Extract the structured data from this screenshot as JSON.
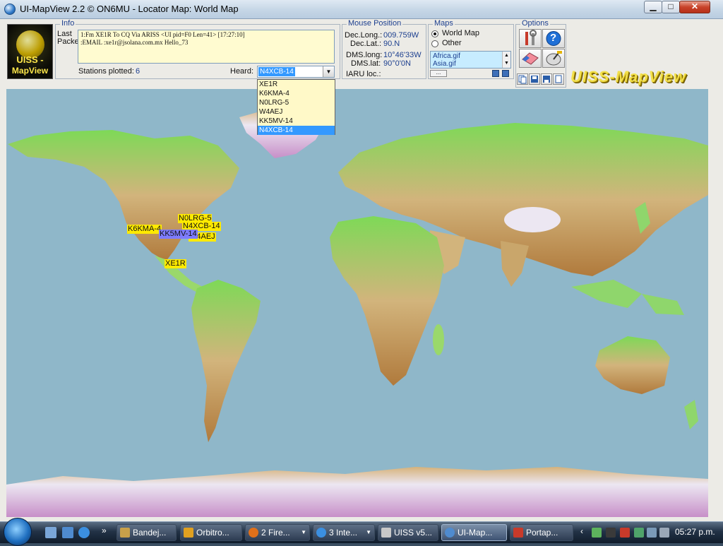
{
  "window": {
    "title": "UI-MapView 2.2 © ON6MU - Locator Map: World Map",
    "controls": {
      "minimize": "▁",
      "maximize": "□",
      "close": "✕"
    }
  },
  "logo": {
    "line1": "UISS -",
    "line2": "MapView"
  },
  "info": {
    "legend": "Info",
    "last_label": "Last",
    "packet_label": "Packet:",
    "packet_lines": [
      "1:Fm XE1R To CQ Via ARISS <UI pid=F0 Len=41> [17:27:10]",
      ":EMAIL   :xe1r@jsolana.com.mx Hello_73"
    ],
    "stations_label": "Stations plotted:",
    "stations_value": "6",
    "heard_label": "Heard:",
    "heard_value": "N4XCB-14",
    "heard_options": [
      "XE1R",
      "K6KMA-4",
      "N0LRG-5",
      "W4AEJ",
      "KK5MV-14",
      "N4XCB-14"
    ]
  },
  "mouse": {
    "legend": "Mouse Position",
    "dec_long_label": "Dec.Long.:",
    "dec_long_value": "009.759W",
    "dec_lat_label": "Dec.Lat.:",
    "dec_lat_value": "90.N",
    "dms_long_label": "DMS.long:",
    "dms_long_value": "10°46'33W",
    "dms_lat_label": "DMS.lat:",
    "dms_lat_value": "90°0'0N",
    "iaru_label": "IARU loc.:"
  },
  "maps": {
    "legend": "Maps",
    "world_label": "World Map",
    "other_label": "Other",
    "selected": "World Map",
    "files": [
      "Africa.gif",
      "Asia.gif"
    ],
    "more_label": "..."
  },
  "options": {
    "legend": "Options",
    "help_label": "?"
  },
  "brand": "UISS-MapView",
  "stations": [
    {
      "call": "XE1R",
      "color": "#ffea00"
    },
    {
      "call": "K6KMA-4",
      "color": "#ffea00"
    },
    {
      "call": "KK5MV-14",
      "color": "#7e7cff"
    },
    {
      "call": "N0LRG-5",
      "color": "#ffea00"
    },
    {
      "call": "N4XCB-14",
      "color": "#ffea00"
    },
    {
      "call": "W4AEJ",
      "color": "#ffea00"
    }
  ],
  "map_colors": {
    "ocean": "#8fb7c9",
    "land_low": "#7ed957",
    "land_mid": "#d2b47c",
    "land_high": "#b07a3c",
    "ice": "#ece7f2"
  },
  "taskbar": {
    "more": "»",
    "tasks": [
      {
        "label": "Bandej...",
        "icon": "folder-icon",
        "active": false
      },
      {
        "label": "Orbitro...",
        "icon": "satellite-icon",
        "active": false
      },
      {
        "label": "2 Fire...",
        "icon": "firefox-icon",
        "active": false
      },
      {
        "label": "3 Inte...",
        "icon": "ie-icon",
        "active": false
      },
      {
        "label": "UISS v5...",
        "icon": "uiss-icon",
        "active": false
      },
      {
        "label": "UI-Map...",
        "icon": "mapview-icon",
        "active": true
      },
      {
        "label": "Portap...",
        "icon": "clipboard-icon",
        "active": false
      }
    ],
    "tray_chevron": "‹",
    "clock": "05:27 p.m."
  }
}
